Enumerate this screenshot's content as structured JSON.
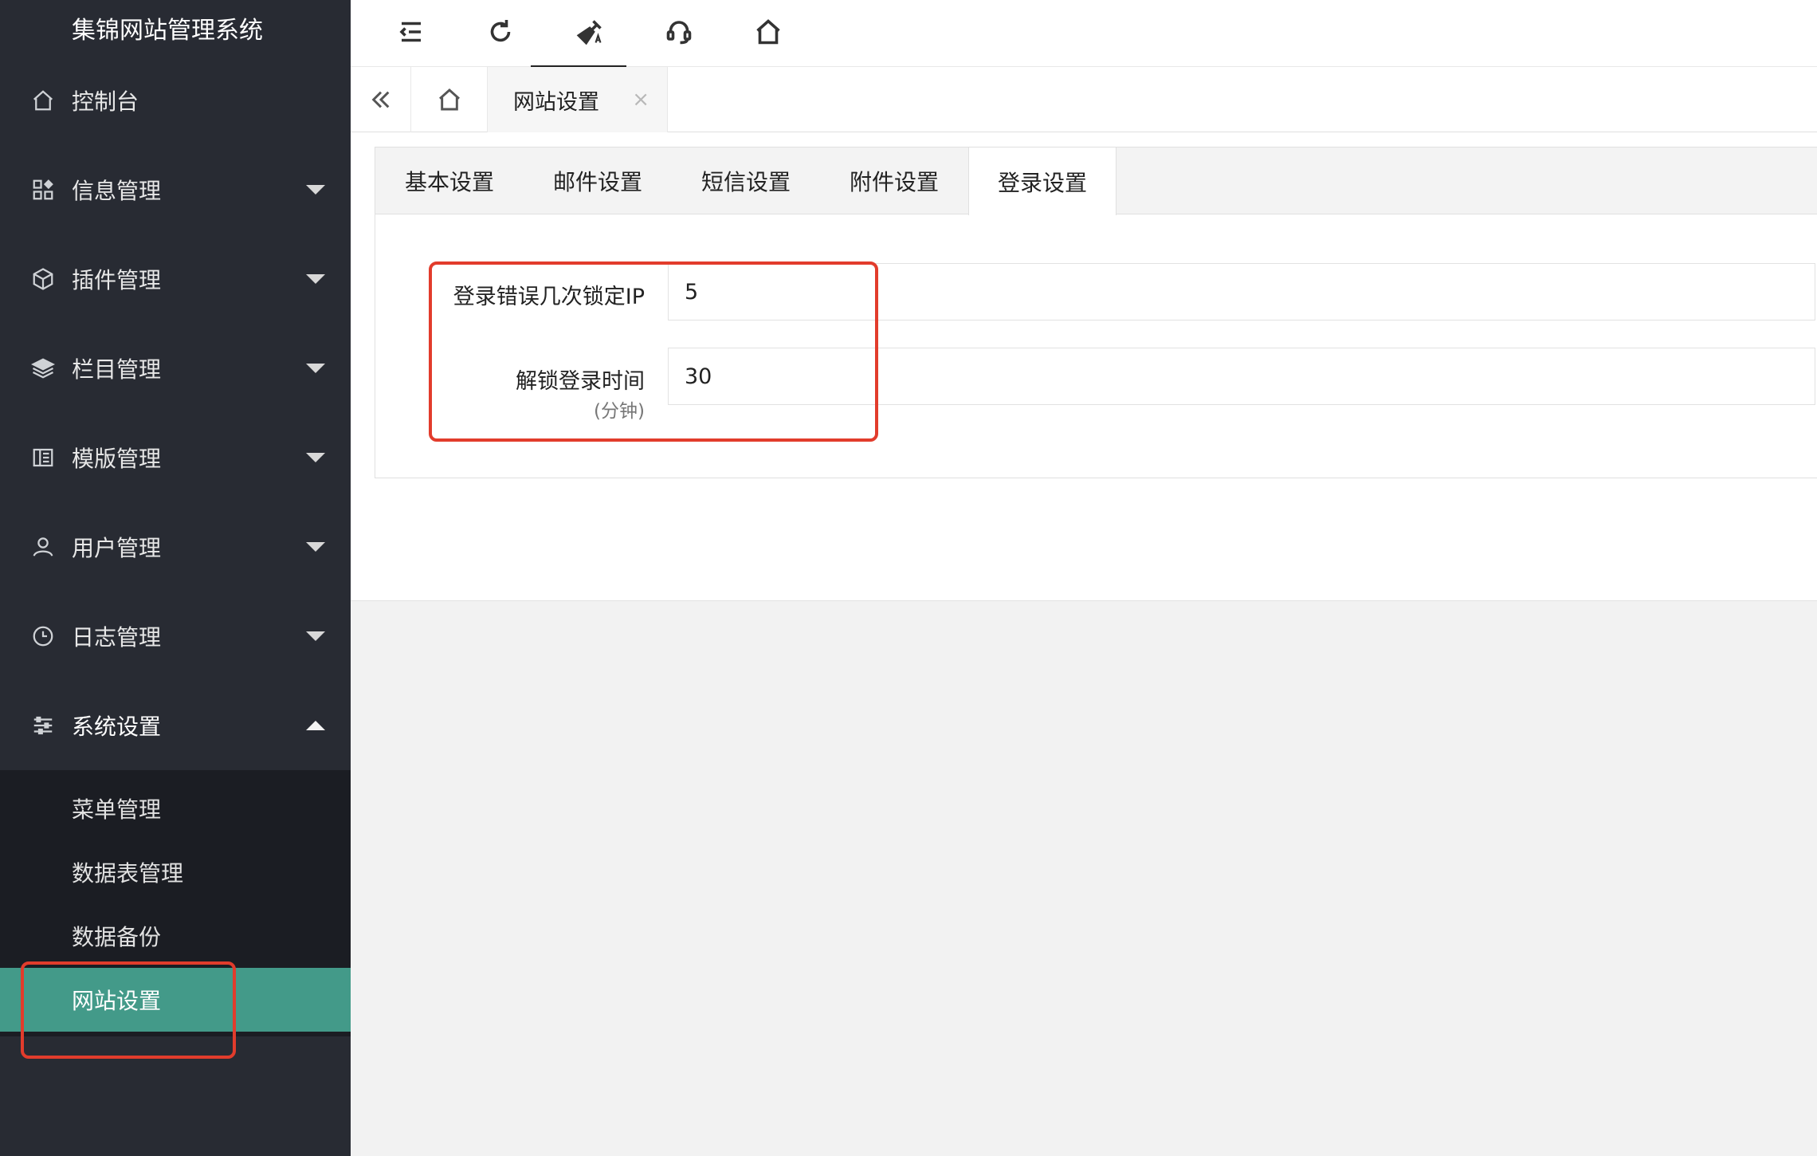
{
  "app": {
    "title": "集锦网站管理系统"
  },
  "sidebar": {
    "items": [
      {
        "label": "控制台",
        "icon": "home-icon",
        "has_arrow": false
      },
      {
        "label": "信息管理",
        "icon": "apps-icon",
        "has_arrow": true
      },
      {
        "label": "插件管理",
        "icon": "cube-icon",
        "has_arrow": true
      },
      {
        "label": "栏目管理",
        "icon": "layers-icon",
        "has_arrow": true
      },
      {
        "label": "模版管理",
        "icon": "template-icon",
        "has_arrow": true
      },
      {
        "label": "用户管理",
        "icon": "user-icon",
        "has_arrow": true
      },
      {
        "label": "日志管理",
        "icon": "clock-icon",
        "has_arrow": true
      },
      {
        "label": "系统设置",
        "icon": "sliders-icon",
        "has_arrow": true,
        "expanded": true
      }
    ],
    "sub_items": [
      {
        "label": "菜单管理"
      },
      {
        "label": "数据表管理"
      },
      {
        "label": "数据备份"
      },
      {
        "label": "网站设置",
        "active": true
      }
    ],
    "active_color": "#439a89"
  },
  "topbar": {
    "icons": [
      "shrink-menu-icon",
      "refresh-icon",
      "clear-cache-icon",
      "support-icon",
      "home-icon"
    ]
  },
  "tabstrip": {
    "open_tab": "网站设置",
    "close_glyph": "×"
  },
  "settings": {
    "tabs": [
      "基本设置",
      "邮件设置",
      "短信设置",
      "附件设置",
      "登录设置"
    ],
    "active_tab": "登录设置",
    "fields": {
      "lock_attempts": {
        "label": "登录错误几次锁定IP",
        "value": "5"
      },
      "unlock_time": {
        "label": "解锁登录时间",
        "sub": "(分钟)",
        "value": "30"
      }
    }
  },
  "colors": {
    "highlight": "#e23c2c",
    "sidebar_bg": "#282b33",
    "accent": "#439a89"
  }
}
